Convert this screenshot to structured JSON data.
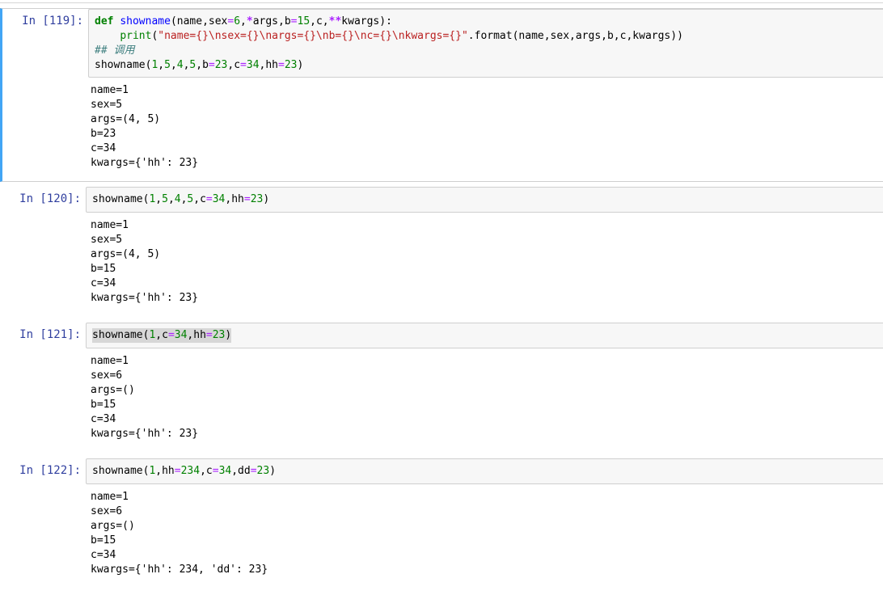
{
  "cells": [
    {
      "prompt": "In [119]:",
      "code": [
        [
          [
            "kw",
            "def"
          ],
          [
            "t",
            " "
          ],
          [
            "fn",
            "showname"
          ],
          [
            "t",
            "(name,sex"
          ],
          [
            "op",
            "="
          ],
          [
            "num",
            "6"
          ],
          [
            "t",
            ","
          ],
          [
            "opb",
            "*"
          ],
          [
            "t",
            "args,b"
          ],
          [
            "op",
            "="
          ],
          [
            "num",
            "15"
          ],
          [
            "t",
            ",c,"
          ],
          [
            "opb",
            "**"
          ],
          [
            "t",
            "kwargs):"
          ]
        ],
        [
          [
            "t",
            "    "
          ],
          [
            "bi",
            "print"
          ],
          [
            "t",
            "("
          ],
          [
            "str",
            "\"name={}\\nsex={}\\nargs={}\\nb={}\\nc={}\\nkwargs={}\""
          ],
          [
            "t",
            ".format(name,sex,args,b,c,kwargs))"
          ]
        ],
        [
          [
            "cm",
            "## 调用"
          ]
        ],
        [
          [
            "t",
            "showname("
          ],
          [
            "num",
            "1"
          ],
          [
            "t",
            ","
          ],
          [
            "num",
            "5"
          ],
          [
            "t",
            ","
          ],
          [
            "num",
            "4"
          ],
          [
            "t",
            ","
          ],
          [
            "num",
            "5"
          ],
          [
            "t",
            ",b"
          ],
          [
            "op",
            "="
          ],
          [
            "num",
            "23"
          ],
          [
            "t",
            ",c"
          ],
          [
            "op",
            "="
          ],
          [
            "num",
            "34"
          ],
          [
            "t",
            ",hh"
          ],
          [
            "op",
            "="
          ],
          [
            "num",
            "23"
          ],
          [
            "t",
            ")"
          ]
        ]
      ],
      "output": [
        "name=1",
        "sex=5",
        "args=(4, 5)",
        "b=23",
        "c=34",
        "kwargs={'hh': 23}"
      ]
    },
    {
      "prompt": "In [120]:",
      "code": [
        [
          [
            "t",
            "showname("
          ],
          [
            "num",
            "1"
          ],
          [
            "t",
            ","
          ],
          [
            "num",
            "5"
          ],
          [
            "t",
            ","
          ],
          [
            "num",
            "4"
          ],
          [
            "t",
            ","
          ],
          [
            "num",
            "5"
          ],
          [
            "t",
            ",c"
          ],
          [
            "op",
            "="
          ],
          [
            "num",
            "34"
          ],
          [
            "t",
            ",hh"
          ],
          [
            "op",
            "="
          ],
          [
            "num",
            "23"
          ],
          [
            "t",
            ")"
          ]
        ]
      ],
      "output": [
        "name=1",
        "sex=5",
        "args=(4, 5)",
        "b=15",
        "c=34",
        "kwargs={'hh': 23}"
      ]
    },
    {
      "prompt": "In [121]:",
      "code": [
        [
          [
            "t",
            "showname("
          ],
          [
            "num",
            "1"
          ],
          [
            "t",
            ",c"
          ],
          [
            "op",
            "="
          ],
          [
            "num",
            "34"
          ],
          [
            "t",
            ",hh"
          ],
          [
            "op",
            "="
          ],
          [
            "num",
            "23"
          ],
          [
            "t",
            ")"
          ]
        ]
      ],
      "output": [
        "name=1",
        "sex=6",
        "args=()",
        "b=15",
        "c=34",
        "kwargs={'hh': 23}"
      ]
    },
    {
      "prompt": "In [122]:",
      "code": [
        [
          [
            "t",
            "showname("
          ],
          [
            "num",
            "1"
          ],
          [
            "t",
            ",hh"
          ],
          [
            "op",
            "="
          ],
          [
            "num",
            "234"
          ],
          [
            "t",
            ",c"
          ],
          [
            "op",
            "="
          ],
          [
            "num",
            "34"
          ],
          [
            "t",
            ",dd"
          ],
          [
            "op",
            "="
          ],
          [
            "num",
            "23"
          ],
          [
            "t",
            ")"
          ]
        ]
      ],
      "output": [
        "name=1",
        "sex=6",
        "args=()",
        "b=15",
        "c=34",
        "kwargs={'hh': 234, 'dd': 23}"
      ]
    }
  ]
}
